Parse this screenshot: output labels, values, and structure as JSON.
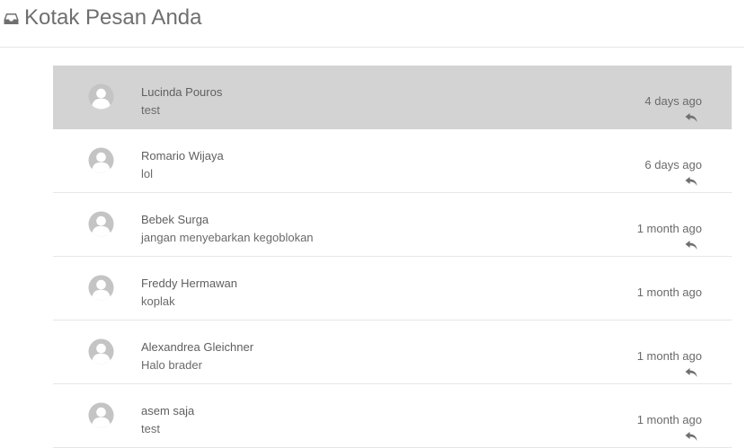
{
  "header": {
    "title": "Kotak Pesan Anda",
    "icon": "inbox-icon"
  },
  "messages": [
    {
      "sender": "Lucinda Pouros",
      "preview": "test",
      "time": "4 days ago",
      "reply": true,
      "active": true
    },
    {
      "sender": "Romario Wijaya",
      "preview": "lol",
      "time": "6 days ago",
      "reply": true,
      "active": false
    },
    {
      "sender": "Bebek Surga",
      "preview": "jangan menyebarkan kegoblokan",
      "time": "1 month ago",
      "reply": true,
      "active": false
    },
    {
      "sender": "Freddy Hermawan",
      "preview": "koplak",
      "time": "1 month ago",
      "reply": false,
      "active": false
    },
    {
      "sender": "Alexandrea Gleichner",
      "preview": "Halo brader",
      "time": "1 month ago",
      "reply": true,
      "active": false
    },
    {
      "sender": "asem saja",
      "preview": "test",
      "time": "1 month ago",
      "reply": true,
      "active": false
    }
  ],
  "colors": {
    "active_row": "#d3d3d3",
    "avatar": "#c4c4c4",
    "divider": "#e6e6e6"
  }
}
